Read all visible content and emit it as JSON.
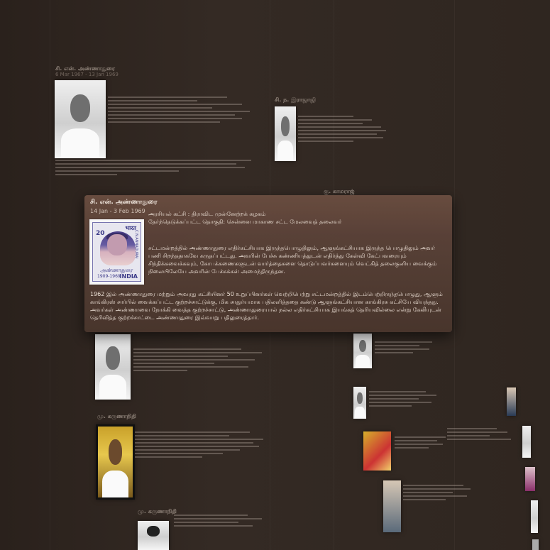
{
  "popup": {
    "name": "சி. என். அண்ணாதுரை",
    "dates": "14 Jan - 3 Feb 1969",
    "party_line": "அரசியல் கட்சி : திராவிட முன்னேற்றக் கழகம்",
    "constituency_line": "தேர்ந்தெடுக்கப்பட்ட தொகுதி: சென்னை மாகாண சட்ட மேலவைத் தலைவர்",
    "para1": "சட்டமன்றத்தில் அண்ணாதுரை எதிர்கட்சியாக இருந்தபொழுதிலும், ஆளுங்கட்சியாக இருந்த பொழுதிலும் அவர் பணி சிறந்ததாகவே கருதப்பட்டது. அவரின் பேச்சு கண்ணியத்துடன் எதிர்த்து கேள்வி கேட்பவரையும் சிந்திக்கவைக்கவும், கோபக்கணைகளுடன் வார்த்தைகளை தொடுப்பவர்களையும் வெட்கித் தலைகுனிய வைக்கும் நிலையிலேயே அவரின் பேச்சுக்கள் அமைந்திருந்தன.",
    "para2": "1962 இல் அண்ணாதுரை மற்றும் அவரது கட்சியினர் 50 உறுப்பினர்கள் வெற்றிபெற்று சட்டமன்றத்தில் இடம்பெற்றிருந்தபொழுது, ஆளும் காங்கிரஸ் சார்பில் வைக்கப்பட்ட குற்றச்சாட்டுக்கு, மிக சாதுர்யமாக பதிலளித்ததை கண்டு ஆளுங்கட்சியான காங்கிரசு கட்சியே வியந்தது. அவர்கள் அண்ணாவை நோக்கி வைத்த குற்றச்சாட்டு, அண்ணாதுரையால் நல்ல எதிர்கட்சியாக இயங்கத் தெரியவில்லை என்று கேலியுடன் தெரிவித்த குற்றச்சாட்டை அண்ணாதுரை இவ்வாறு பதிலுரைத்தார்."
  },
  "stamp": {
    "country": "भारत",
    "value": "20",
    "name_vertical": "C.N.ANNADURAI",
    "signature": "அண்ணாதுரை",
    "years": "1909-1969",
    "india": "INDIA"
  },
  "cards": [
    {
      "name": "சி. என். அண்ணாதுரை",
      "date": "6 Mar 1967 - 13 Jan 1969"
    },
    {
      "name": "சி. ந. இராஜாஜி",
      "date": ""
    },
    {
      "name": "கு. காமராஜ்",
      "date": ""
    },
    {
      "name": "மு. கருணாநிதி",
      "date": ""
    },
    {
      "name": "மு. கருணாநிதி",
      "date": ""
    }
  ]
}
